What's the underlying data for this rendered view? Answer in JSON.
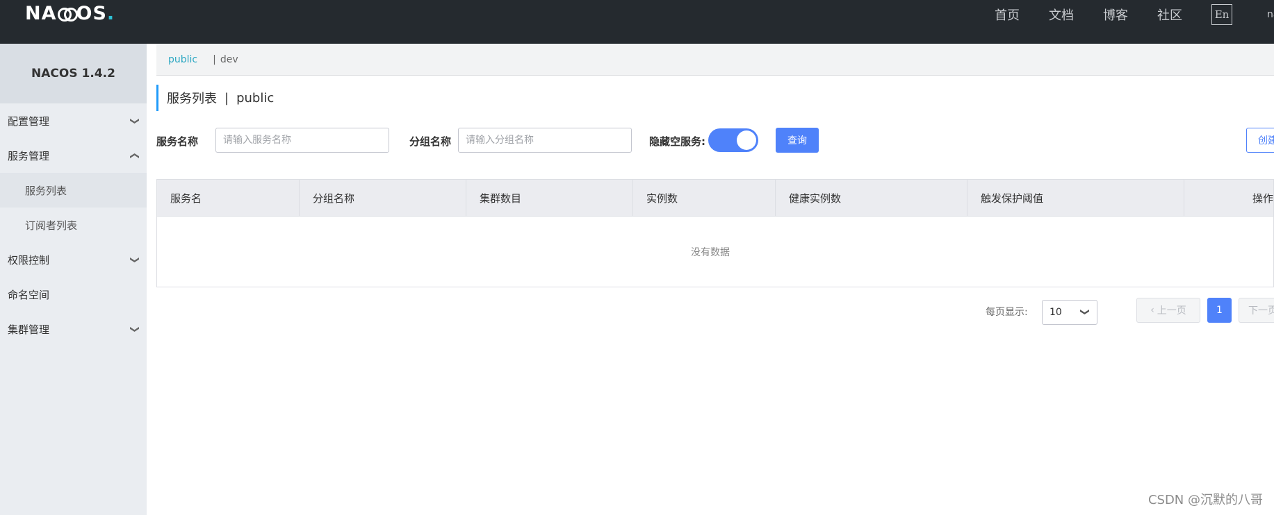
{
  "header": {
    "logo_main": "NA",
    "logo_o": "",
    "logo_tail": "OS",
    "logo_dot": ".",
    "nav": [
      "首页",
      "文档",
      "博客",
      "社区"
    ],
    "lang_button": "En",
    "user_partial": "na"
  },
  "sidebar": {
    "version": "NACOS 1.4.2",
    "items": [
      {
        "label": "配置管理",
        "expanded": false
      },
      {
        "label": "服务管理",
        "expanded": true
      },
      {
        "label": "服务列表",
        "sub": true,
        "active": true
      },
      {
        "label": "订阅者列表",
        "sub": true
      },
      {
        "label": "权限控制",
        "expanded": false
      },
      {
        "label": "命名空间"
      },
      {
        "label": "集群管理",
        "expanded": false
      }
    ]
  },
  "namespaces": {
    "active": "public",
    "separator": "|",
    "other": "dev"
  },
  "page": {
    "title": "服务列表",
    "title_sep": "|",
    "namespace": "public"
  },
  "filters": {
    "service_name_label": "服务名称",
    "service_name_placeholder": "请输入服务名称",
    "group_name_label": "分组名称",
    "group_name_placeholder": "请输入分组名称",
    "hide_empty_label": "隐藏空服务:",
    "hide_empty_on": true,
    "query_button": "查询",
    "create_button": "创建服务"
  },
  "table": {
    "columns": [
      "服务名",
      "分组名称",
      "集群数目",
      "实例数",
      "健康实例数",
      "触发保护阈值",
      "操作"
    ],
    "empty_text": "没有数据"
  },
  "pagination": {
    "page_size_label": "每页显示:",
    "page_size": "10",
    "prev": "上一页",
    "current": "1",
    "next": "下一页"
  },
  "watermark": "CSDN @沉默的八哥",
  "colors": {
    "topbar": "#252a2f",
    "primary": "#4f82fa",
    "namespace_active": "#2ca7c2",
    "sidebar_bg": "#eaedf1"
  }
}
